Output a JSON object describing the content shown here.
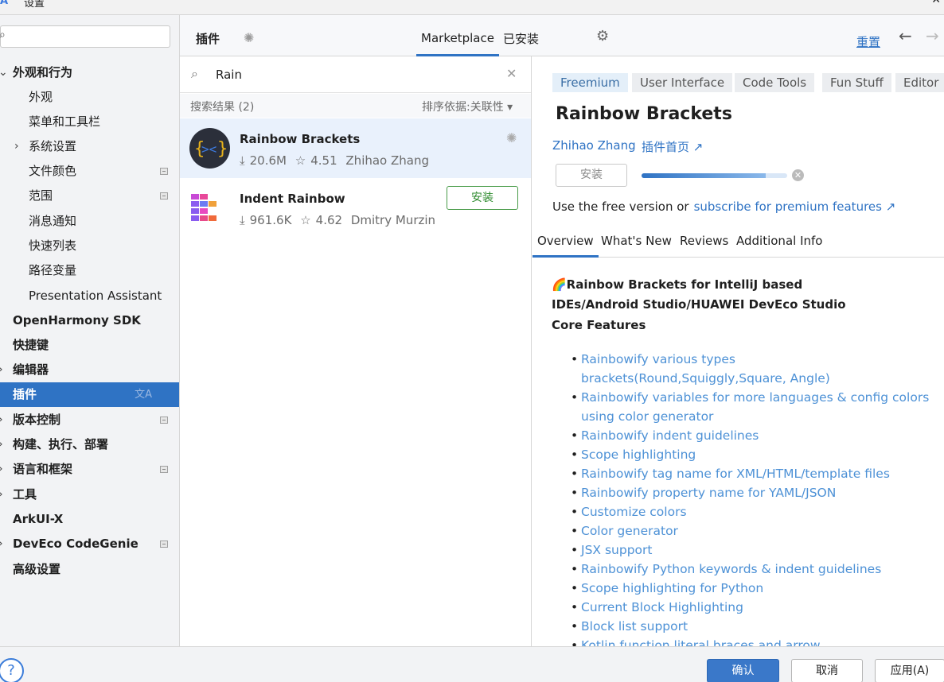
{
  "window": {
    "title": "设置",
    "close_glyph": "✕"
  },
  "sidebar": {
    "search_placeholder": "",
    "items": [
      {
        "label": "外观和行为",
        "arrow": "⌄",
        "bold": true
      },
      {
        "label": "外观"
      },
      {
        "label": "菜单和工具栏"
      },
      {
        "label": "系统设置",
        "arrow": "›"
      },
      {
        "label": "文件颜色"
      },
      {
        "label": "范围"
      },
      {
        "label": "消息通知"
      },
      {
        "label": "快速列表"
      },
      {
        "label": "路径变量"
      },
      {
        "label": "Presentation Assistant"
      },
      {
        "label": "OpenHarmony SDK"
      },
      {
        "label": "快捷键"
      },
      {
        "label": "编辑器",
        "arrow": "›"
      },
      {
        "label": "插件"
      },
      {
        "label": "版本控制",
        "arrow": "›"
      },
      {
        "label": "构建、执行、部署",
        "arrow": "›"
      },
      {
        "label": "语言和框架",
        "arrow": "›"
      },
      {
        "label": "工具",
        "arrow": "›"
      },
      {
        "label": "ArkUI-X"
      },
      {
        "label": "DevEco CodeGenie",
        "arrow": "›"
      },
      {
        "label": "高级设置"
      }
    ]
  },
  "header": {
    "title": "插件",
    "tabs": [
      "Marketplace",
      "已安装"
    ],
    "active_tab": "Marketplace",
    "reset_label": "重置"
  },
  "plugin_list": {
    "query": "Rain",
    "results_label": "搜索结果 (2)",
    "sort_label": "排序依据:关联性 ▾",
    "plugins": [
      {
        "name": "Rainbow Brackets",
        "downloads": "20.6M",
        "rating": "4.51",
        "author": "Zhihao Zhang",
        "state": "installing"
      },
      {
        "name": "Indent Rainbow",
        "downloads": "961.6K",
        "rating": "4.62",
        "author": "Dmitry Murzin",
        "install_label": "安装"
      }
    ]
  },
  "detail": {
    "tags": [
      "Freemium",
      "User Interface",
      "Code Tools",
      "Fun Stuff",
      "Editor"
    ],
    "title": "Rainbow Brackets",
    "author": "Zhihao Zhang",
    "homepage": "插件首页 ↗",
    "install_label": "安装",
    "progress": 0.85,
    "free_text": "Use the free version or",
    "premium_link": "subscribe for premium features ↗",
    "tabs": [
      "Overview",
      "What's New",
      "Reviews",
      "Additional Info"
    ],
    "active_tab": "Overview",
    "heading": "🌈Rainbow Brackets for IntelliJ based IDEs/Android Studio/HUAWEI DevEco Studio",
    "core_label": "Core Features",
    "features": [
      "Rainbowify various types brackets(Round,Squiggly,Square, Angle)",
      "Rainbowify variables for more languages & config colors using color generator",
      "Rainbowify indent guidelines",
      "Scope highlighting",
      "Rainbowify tag name for XML/HTML/template files",
      "Rainbowify property name for YAML/JSON",
      "Customize colors",
      "Color generator",
      "JSX support",
      "Rainbowify Python keywords & indent guidelines",
      "Scope highlighting for Python",
      "Current Block Highlighting",
      "Block list support",
      "Kotlin function literal braces and arrow"
    ]
  },
  "footer": {
    "help_glyph": "?",
    "ok_label": "确认",
    "cancel_label": "取消",
    "apply_label": "应用(A)"
  },
  "colors": {
    "accent": "#2f73c4",
    "link": "#4d91d6",
    "install_green": "#2d8a2d"
  }
}
